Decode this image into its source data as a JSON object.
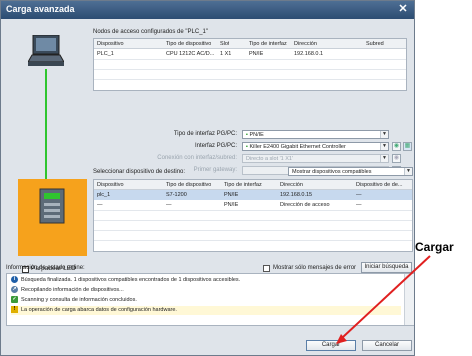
{
  "window": {
    "title": "Carga avanzada",
    "close_glyph": "✕"
  },
  "nodes": {
    "label": "Nodos de acceso configurados de \"PLC_1\"",
    "columns": [
      "Dispositivo",
      "Tipo de dispositivo",
      "Slot",
      "Tipo de interfaz",
      "Dirección",
      "Subred"
    ],
    "row": [
      "PLC_1",
      "CPU 1212C AC/D...",
      "1 X1",
      "PN/IE",
      "192.168.0.1",
      ""
    ]
  },
  "iface": {
    "type_label": "Tipo de interfaz PG/PC:",
    "type_value": "PN/IE",
    "iface_label": "Interfaz PG/PC:",
    "iface_value": "Killer E2400 Gigabit Ethernet Controller",
    "conn_label": "Conexión con interfaz/subred:",
    "conn_value": "Directo a slot '1 X1'",
    "gw_label": "Primer gateway:",
    "gw_value": ""
  },
  "target": {
    "label": "Seleccionar dispositivo de destino:",
    "filter_value": "Mostrar dispositivos compatibles",
    "columns": [
      "Dispositivo",
      "Tipo de dispositivo",
      "Tipo de interfaz",
      "Dirección",
      "Dispositivo de de..."
    ],
    "rows": [
      [
        "plc_1",
        "S7-1200",
        "PN/IE",
        "192.168.0.15",
        "—"
      ],
      [
        "—",
        "—",
        "PN/IE",
        "Dirección de acceso",
        "—"
      ]
    ],
    "blink_led": "Parpadear LED",
    "start_search": "Iniciar búsqueda"
  },
  "status": {
    "label": "Información de estado online:",
    "only_errors": "Mostrar sólo mensajes de error",
    "messages": [
      {
        "icon": "info-icon",
        "color": "#1f5fa8",
        "text": "Búsqueda finalizada. 1 dispositivos compatibles encontrados de 1 dispositivos accesibles."
      },
      {
        "icon": "search-icon",
        "color": "#5a7fa8",
        "text": "Recopilando información de dispositivos..."
      },
      {
        "icon": "check-icon",
        "color": "#3a9a3a",
        "text": "Scanning y consulta de información concluidos."
      },
      {
        "icon": "warning-icon",
        "color": "#e0b000",
        "text": "La operación de carga abarca datos de configuración hardware."
      }
    ]
  },
  "buttons": {
    "load": "Cargar",
    "cancel": "Cancelar"
  },
  "annotation": {
    "text": "Cargar",
    "color": "#e02020"
  }
}
